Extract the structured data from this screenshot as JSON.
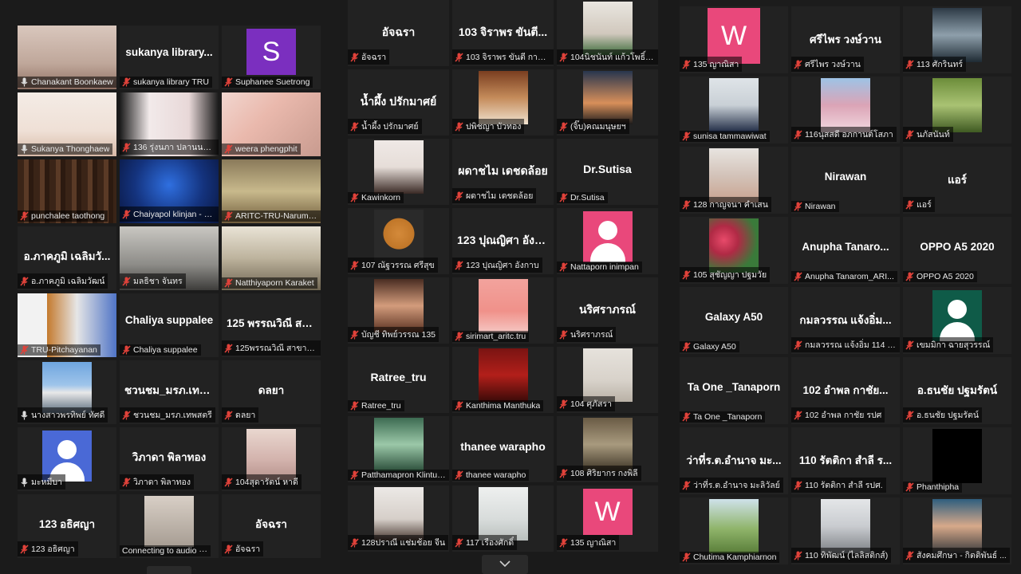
{
  "colors": {
    "tile_bg": "#222222",
    "active_border": "#e7d44a",
    "muted_mic": "#e0423a",
    "pink_avatar": "#e9487b",
    "purple_avatar": "#7b2fbf",
    "blue_avatar": "#4a69d6",
    "teal_avatar": "#0f5b48"
  },
  "galleries": [
    {
      "tiles": [
        {
          "name": "Chanakant Boonkaew",
          "kind": "video",
          "scene": "face-light",
          "muted": false
        },
        {
          "name": "sukanya library TRU",
          "big": "sukanya library...",
          "kind": "name",
          "muted": true
        },
        {
          "name": "Suphanee Suetrong",
          "letter": "S",
          "kind": "letter",
          "letter_color": "#7b2fbf",
          "muted": true
        },
        {
          "name": "Sukanya Thonghaew",
          "kind": "video",
          "scene": "face-white",
          "muted": false,
          "active": true
        },
        {
          "name": "136 รุ่งนภา ปลานนา มร...",
          "kind": "video",
          "scene": "blur",
          "muted": true
        },
        {
          "name": "weera phengphit",
          "kind": "video",
          "scene": "slide",
          "muted": true
        },
        {
          "name": "punchalee taothong",
          "kind": "video",
          "scene": "library",
          "muted": true
        },
        {
          "name": "Chaiyapol klinjan - มร...",
          "kind": "video",
          "scene": "tech",
          "muted": true
        },
        {
          "name": "ARITC-TRU-Narumon",
          "kind": "video",
          "scene": "office",
          "muted": true
        },
        {
          "name": "อ.ภาคภูมิ เฉลิมวัฒน์",
          "big": "อ.ภาคภูมิ เฉลิมวั...",
          "kind": "name",
          "muted": true
        },
        {
          "name": "มลธิชา จันทร",
          "kind": "video",
          "scene": "room",
          "muted": true
        },
        {
          "name": "Natthiyaporn Karaket",
          "kind": "video",
          "scene": "building",
          "muted": true
        },
        {
          "name": "TRU-Pitchayanan",
          "kind": "video",
          "scene": "logo",
          "muted": true
        },
        {
          "name": "Chaliya suppalee",
          "big": "Chaliya suppalee",
          "kind": "name",
          "muted": true
        },
        {
          "name": "125พรรณวิณี สาขาวิทย...",
          "big": "125 พรรณวิณี สา...",
          "kind": "name",
          "muted": true
        },
        {
          "name": "นางสาวพรทิพย์ ทัศดี",
          "kind": "photo",
          "scene": "temple",
          "muted": false
        },
        {
          "name": "ชวนชม_มรภ.เทพสตรี",
          "big": "ชวนชม_มรภ.เทพ...",
          "kind": "name",
          "muted": true
        },
        {
          "name": "ดลยา",
          "big": "ดลยา",
          "kind": "name",
          "muted": true
        },
        {
          "name": "มะหมีบา",
          "kind": "avatar",
          "avatar_color": "#4a69d6",
          "muted": false
        },
        {
          "name": "วิภาดา พิลาทอง",
          "big": "วิภาดา พิลาทอง",
          "kind": "name",
          "muted": true
        },
        {
          "name": "104สุดารัตน์ หาดี",
          "kind": "photo",
          "scene": "drawing",
          "muted": true
        },
        {
          "name": "123 อธิศญา",
          "big": "123 อธิศญา",
          "kind": "name",
          "muted": true
        },
        {
          "name": "Connecting to audio ···",
          "kind": "photo",
          "scene": "connecting",
          "muted": false
        },
        {
          "name": "อัจฉรา",
          "big": "อัจฉรา",
          "kind": "name",
          "muted": true
        }
      ]
    },
    {
      "tiles": [
        {
          "name": "อัจฉรา",
          "big": "อัจฉรา",
          "kind": "name",
          "muted": true
        },
        {
          "name": "103 จิราพร ขันตี การบัญชี",
          "big": "103 จิราพร ขันตี...",
          "kind": "name",
          "muted": true
        },
        {
          "name": "104นิชนันท์ แก้วโพธิ์ทอง",
          "kind": "photo",
          "scene": "xmas",
          "muted": true
        },
        {
          "name": "น้ำผึ้ง ปรักมาศย์",
          "big": "น้ำผึ้ง ปรักมาศย์",
          "kind": "name",
          "muted": true
        },
        {
          "name": "ปพิชญา บัวทอง",
          "kind": "photo",
          "scene": "cafe",
          "muted": true
        },
        {
          "name": "(จิ๊บ)คณมนุษยฯ",
          "kind": "photo",
          "scene": "sunset",
          "muted": true
        },
        {
          "name": "Kawinkorn",
          "kind": "photo",
          "scene": "girl-pale",
          "muted": true
        },
        {
          "name": "ผดาชไม เดชดล้อย",
          "big": "ผดาชไม เดชดล้อย",
          "kind": "name",
          "muted": true
        },
        {
          "name": "Dr.Sutisa",
          "big": "Dr.Sutisa",
          "kind": "name",
          "muted": true
        },
        {
          "name": "107 ณัฐวรรณ ศรีสุข",
          "kind": "photo",
          "scene": "bear",
          "muted": true
        },
        {
          "name": "123 ปุณญิศา อังกาบ",
          "big": "123 ปุณญิศา อังกาบ",
          "kind": "name",
          "muted": true
        },
        {
          "name": "Nattaporn inimpan",
          "kind": "avatar",
          "avatar_color": "#e9487b",
          "muted": true
        },
        {
          "name": "บัญชี ทิพย์วรรณ 135",
          "kind": "photo",
          "scene": "girl-warm",
          "muted": true
        },
        {
          "name": "sirimart_aritc.tru",
          "kind": "photo",
          "scene": "tru-library",
          "muted": true
        },
        {
          "name": "นริศราภรณ์",
          "big": "นริศราภรณ์",
          "kind": "name",
          "muted": true
        },
        {
          "name": "Ratree_tru",
          "big": "Ratree_tru",
          "kind": "name",
          "muted": true
        },
        {
          "name": "Kanthima Manthuka",
          "kind": "photo",
          "scene": "red-poster",
          "muted": true
        },
        {
          "name": "104 ศุภัสรา",
          "kind": "photo",
          "scene": "sit",
          "muted": true
        },
        {
          "name": "Patthamapron Klintue...",
          "kind": "photo",
          "scene": "girl-green",
          "muted": true
        },
        {
          "name": "thanee warapho",
          "big": "thanee warapho",
          "kind": "name",
          "muted": true
        },
        {
          "name": "108 ศิริยากร กงพิลี",
          "kind": "photo",
          "scene": "outdoor",
          "muted": true
        },
        {
          "name": "128ปราณี แช่มช้อย จีน",
          "kind": "photo",
          "scene": "girl-white",
          "muted": true
        },
        {
          "name": "117 เรืองศักดิ์",
          "kind": "photo",
          "scene": "liberty",
          "muted": true
        },
        {
          "name": "135 ญาณิสา",
          "letter": "W",
          "kind": "letter",
          "letter_color": "#e9487b",
          "muted": true
        }
      ]
    },
    {
      "tiles": [
        {
          "name": "135 ญาณิสา",
          "letter": "W",
          "kind": "letter",
          "letter_color": "#e9487b",
          "muted": true
        },
        {
          "name": "ศรีไพร วงษ์วาน",
          "big": "ศรีไพร วงษ์วาน",
          "kind": "name",
          "muted": true
        },
        {
          "name": "113 ศักรินทร์",
          "kind": "photo",
          "scene": "mirror",
          "muted": true
        },
        {
          "name": "sunisa tammawiwat",
          "kind": "photo",
          "scene": "woman-suit",
          "muted": true
        },
        {
          "name": "116นุสสดี อภกานต์โสภา",
          "kind": "photo",
          "scene": "sky",
          "muted": true
        },
        {
          "name": "นภัสนันท์",
          "kind": "photo",
          "scene": "park",
          "muted": true
        },
        {
          "name": "128 กาญจนา คำเสน",
          "kind": "photo",
          "scene": "woman-smile",
          "muted": true
        },
        {
          "name": "Nirawan",
          "big": "Nirawan",
          "kind": "name",
          "muted": true
        },
        {
          "name": "แอร์",
          "big": "แอร์",
          "kind": "name",
          "muted": true
        },
        {
          "name": "105 สุชัญญา ปฐมวัย",
          "kind": "photo",
          "scene": "flowers",
          "muted": true
        },
        {
          "name": "Anupha Tanarom_ARI...",
          "big": "Anupha Tanaro...",
          "kind": "name",
          "muted": true
        },
        {
          "name": "OPPO A5 2020",
          "big": "OPPO A5 2020",
          "kind": "name",
          "muted": true
        },
        {
          "name": "Galaxy A50",
          "big": "Galaxy A50",
          "kind": "name",
          "muted": true
        },
        {
          "name": "กมลวรรณ แจ้งอิ่ม 114 วิ...",
          "big": "กมลวรรณ แจ้งอิ่ม...",
          "kind": "name",
          "muted": true
        },
        {
          "name": "เขมมิกา ฉายสุวรรณ์",
          "kind": "avatar",
          "avatar_color": "#0f5b48",
          "muted": true
        },
        {
          "name": "Ta One _Tanaporn",
          "big": "Ta One _Tanaporn",
          "kind": "name",
          "muted": true
        },
        {
          "name": "102 อำพล กาชัย รปศ",
          "big": "102 อำพล กาชัย...",
          "kind": "name",
          "muted": true
        },
        {
          "name": "อ.ธนชัย ปฐมรัตน์",
          "big": "อ.ธนชัย ปฐมรัตน์",
          "kind": "name",
          "muted": true
        },
        {
          "name": "ว่าที่ร.ต.อำนาจ มะลิวัลย์",
          "big": "ว่าที่ร.ต.อำนาจ มะ...",
          "kind": "name",
          "muted": true
        },
        {
          "name": "110 รัตติกา สำลี รปศ.",
          "big": "110 รัตติกา สำลี ร...",
          "kind": "name",
          "muted": true
        },
        {
          "name": "Phanthipha",
          "kind": "photo",
          "scene": "black",
          "muted": true
        },
        {
          "name": "Chutima Kamphiarnon",
          "kind": "photo",
          "scene": "field",
          "muted": true
        },
        {
          "name": "110 ทิพัฒน์ (ไลลิสติกส์)",
          "kind": "photo",
          "scene": "girl-city",
          "muted": true
        },
        {
          "name": "สังคมศึกษา - กิตติพันธ์ ...",
          "kind": "photo",
          "scene": "man-smile",
          "muted": true
        }
      ]
    }
  ]
}
